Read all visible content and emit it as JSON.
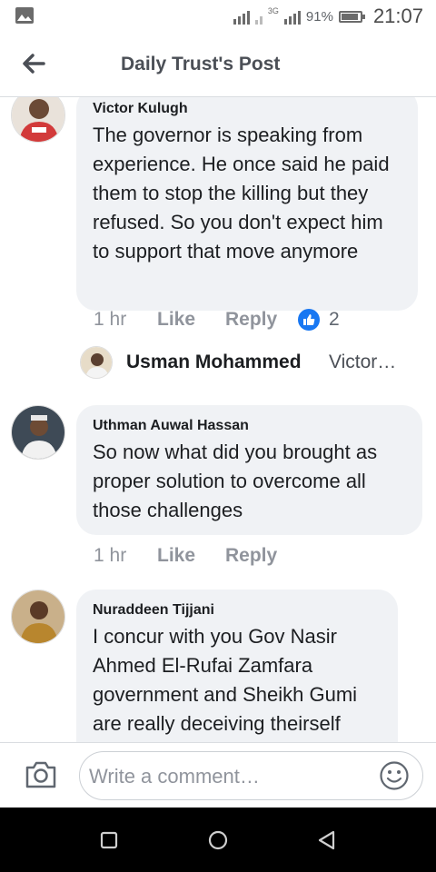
{
  "status_bar": {
    "network_type": "3G",
    "battery_percent": "91%",
    "battery_level": 0.91,
    "time": "21:07"
  },
  "header": {
    "title": "Daily Trust's Post",
    "back_icon": "back-arrow-icon"
  },
  "comments": [
    {
      "author": "Victor Kulugh",
      "text": "The governor is speaking from experience. He once said he paid them to stop the killing but they refused. So you don't expect him to support that move anymore",
      "time": "1 hr",
      "like_label": "Like",
      "reply_label": "Reply",
      "reaction_icon": "thumbs-up-icon",
      "reaction_count": "2",
      "reply_preview": {
        "author": "Usman Mohammed",
        "snippet": "Victor…"
      }
    },
    {
      "author": "Uthman Auwal Hassan",
      "text": "So now what did you brought as proper solution to overcome all those challenges",
      "time": "1 hr",
      "like_label": "Like",
      "reply_label": "Reply"
    },
    {
      "author": "Nuraddeen Tijjani",
      "text": "I concur with you Gov Nasir Ahmed El-Rufai Zamfara government and Sheikh Gumi are really deceiving theirself"
    }
  ],
  "composer": {
    "placeholder": "Write a comment…",
    "camera_icon": "camera-icon",
    "emoji_icon": "emoji-icon"
  },
  "nav_bar": {
    "recents_icon": "recents-square-icon",
    "home_icon": "home-circle-icon",
    "back_icon": "back-triangle-icon"
  },
  "colors": {
    "accent": "#1877f2",
    "bubble": "#f0f2f5",
    "muted_text": "#90949c"
  }
}
